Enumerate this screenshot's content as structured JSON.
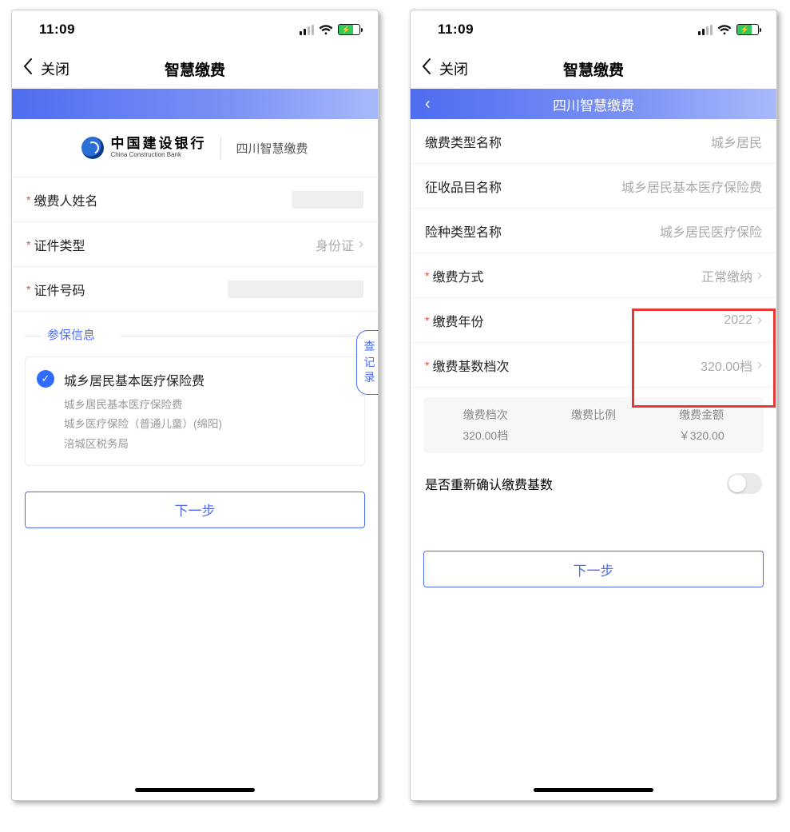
{
  "status": {
    "time": "11:09"
  },
  "nav": {
    "close": "关闭",
    "title": "智慧缴费"
  },
  "left": {
    "bank": {
      "name_cn": "中国建设银行",
      "name_en": "China Construction Bank",
      "subtitle": "四川智慧缴费"
    },
    "fields": {
      "name_label": "缴费人姓名",
      "idtype_label": "证件类型",
      "idtype_value": "身份证",
      "idno_label": "证件号码"
    },
    "section_label": "参保信息",
    "query_tab": "查记录",
    "card": {
      "title": "城乡居民基本医疗保险费",
      "l1": "城乡居民基本医疗保险费",
      "l2": "城乡医疗保险（普通儿童）(绵阳)",
      "l3": "涪城区税务局"
    },
    "next": "下一步"
  },
  "right": {
    "banner_title": "四川智慧缴费",
    "fields": {
      "type_label": "缴费类型名称",
      "type_value": "城乡居民",
      "item_label": "征收品目名称",
      "item_value": "城乡居民基本医疗保险费",
      "kind_label": "险种类型名称",
      "kind_value": "城乡居民医疗保险",
      "method_label": "缴费方式",
      "method_value": "正常缴纳",
      "year_label": "缴费年份",
      "year_value": "2022",
      "tier_label": "缴费基数档次",
      "tier_value": "320.00档"
    },
    "summary": {
      "tier_h": "缴费档次",
      "tier_v": "320.00档",
      "ratio_h": "缴费比例",
      "ratio_v": "",
      "amt_h": "缴费金额",
      "amt_v": "￥320.00"
    },
    "confirm_label": "是否重新确认缴费基数",
    "next": "下一步"
  }
}
